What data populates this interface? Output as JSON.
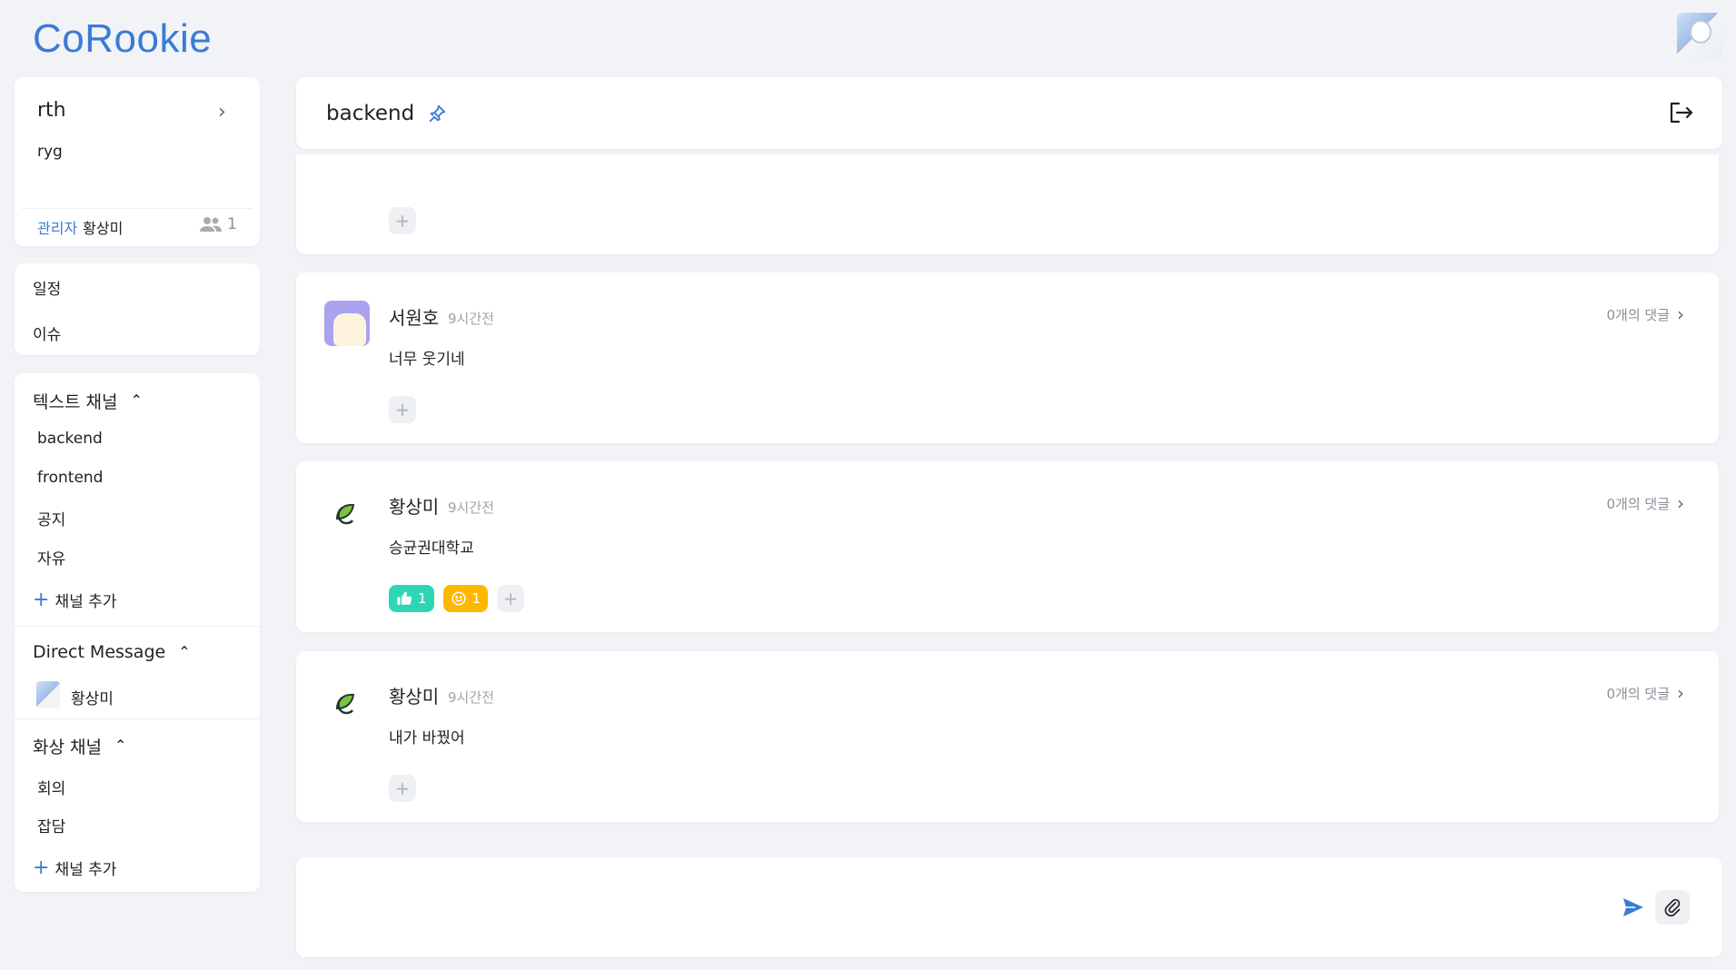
{
  "app": {
    "logo": "CoRookie"
  },
  "workspace": {
    "name": "rth",
    "description": "ryg",
    "admin_role": "관리자",
    "admin_name": "황상미",
    "member_count": "1"
  },
  "menu": {
    "items": [
      {
        "label": "일정"
      },
      {
        "label": "이슈"
      }
    ]
  },
  "text_channels": {
    "title": "텍스트 채널",
    "items": [
      {
        "label": "backend"
      },
      {
        "label": "frontend"
      },
      {
        "label": "공지"
      },
      {
        "label": "자유"
      }
    ],
    "add_label": "채널 추가"
  },
  "direct_message": {
    "title": "Direct Message",
    "items": [
      {
        "label": "황상미"
      }
    ]
  },
  "video_channels": {
    "title": "화상 채널",
    "items": [
      {
        "label": "회의"
      },
      {
        "label": "잡담"
      }
    ],
    "add_label": "채널 추가"
  },
  "channel_header": {
    "title": "backend"
  },
  "messages": [
    {
      "author": "서원호",
      "time": "9시간전",
      "text": "너무 웃기네",
      "comments": "0개의 댓글",
      "reactions": []
    },
    {
      "author": "황상미",
      "time": "9시간전",
      "text": "승균권대학교",
      "comments": "0개의 댓글",
      "reactions": [
        {
          "type": "thumbs-up",
          "count": "1",
          "color": "#2fd6b4"
        },
        {
          "type": "smile",
          "count": "1",
          "color": "#ffb800"
        }
      ]
    },
    {
      "author": "황상미",
      "time": "9시간전",
      "text": "내가 바꿨어",
      "comments": "0개의 댓글",
      "reactions": []
    }
  ],
  "colors": {
    "accent": "#3a7bd5",
    "background": "#f2f3f7"
  },
  "icons": {
    "pin": "pin-icon",
    "exit": "exit-icon",
    "send": "send-icon",
    "attach": "paperclip-icon",
    "members": "people-icon"
  }
}
